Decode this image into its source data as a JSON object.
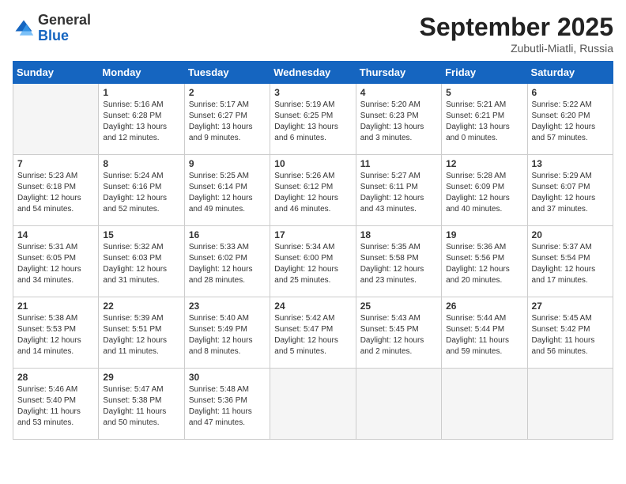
{
  "header": {
    "logo_general": "General",
    "logo_blue": "Blue",
    "month_year": "September 2025",
    "location": "Zubutli-Miatli, Russia"
  },
  "days_of_week": [
    "Sunday",
    "Monday",
    "Tuesday",
    "Wednesday",
    "Thursday",
    "Friday",
    "Saturday"
  ],
  "weeks": [
    [
      {
        "day": "",
        "info": ""
      },
      {
        "day": "1",
        "info": "Sunrise: 5:16 AM\nSunset: 6:28 PM\nDaylight: 13 hours\nand 12 minutes."
      },
      {
        "day": "2",
        "info": "Sunrise: 5:17 AM\nSunset: 6:27 PM\nDaylight: 13 hours\nand 9 minutes."
      },
      {
        "day": "3",
        "info": "Sunrise: 5:19 AM\nSunset: 6:25 PM\nDaylight: 13 hours\nand 6 minutes."
      },
      {
        "day": "4",
        "info": "Sunrise: 5:20 AM\nSunset: 6:23 PM\nDaylight: 13 hours\nand 3 minutes."
      },
      {
        "day": "5",
        "info": "Sunrise: 5:21 AM\nSunset: 6:21 PM\nDaylight: 13 hours\nand 0 minutes."
      },
      {
        "day": "6",
        "info": "Sunrise: 5:22 AM\nSunset: 6:20 PM\nDaylight: 12 hours\nand 57 minutes."
      }
    ],
    [
      {
        "day": "7",
        "info": "Sunrise: 5:23 AM\nSunset: 6:18 PM\nDaylight: 12 hours\nand 54 minutes."
      },
      {
        "day": "8",
        "info": "Sunrise: 5:24 AM\nSunset: 6:16 PM\nDaylight: 12 hours\nand 52 minutes."
      },
      {
        "day": "9",
        "info": "Sunrise: 5:25 AM\nSunset: 6:14 PM\nDaylight: 12 hours\nand 49 minutes."
      },
      {
        "day": "10",
        "info": "Sunrise: 5:26 AM\nSunset: 6:12 PM\nDaylight: 12 hours\nand 46 minutes."
      },
      {
        "day": "11",
        "info": "Sunrise: 5:27 AM\nSunset: 6:11 PM\nDaylight: 12 hours\nand 43 minutes."
      },
      {
        "day": "12",
        "info": "Sunrise: 5:28 AM\nSunset: 6:09 PM\nDaylight: 12 hours\nand 40 minutes."
      },
      {
        "day": "13",
        "info": "Sunrise: 5:29 AM\nSunset: 6:07 PM\nDaylight: 12 hours\nand 37 minutes."
      }
    ],
    [
      {
        "day": "14",
        "info": "Sunrise: 5:31 AM\nSunset: 6:05 PM\nDaylight: 12 hours\nand 34 minutes."
      },
      {
        "day": "15",
        "info": "Sunrise: 5:32 AM\nSunset: 6:03 PM\nDaylight: 12 hours\nand 31 minutes."
      },
      {
        "day": "16",
        "info": "Sunrise: 5:33 AM\nSunset: 6:02 PM\nDaylight: 12 hours\nand 28 minutes."
      },
      {
        "day": "17",
        "info": "Sunrise: 5:34 AM\nSunset: 6:00 PM\nDaylight: 12 hours\nand 25 minutes."
      },
      {
        "day": "18",
        "info": "Sunrise: 5:35 AM\nSunset: 5:58 PM\nDaylight: 12 hours\nand 23 minutes."
      },
      {
        "day": "19",
        "info": "Sunrise: 5:36 AM\nSunset: 5:56 PM\nDaylight: 12 hours\nand 20 minutes."
      },
      {
        "day": "20",
        "info": "Sunrise: 5:37 AM\nSunset: 5:54 PM\nDaylight: 12 hours\nand 17 minutes."
      }
    ],
    [
      {
        "day": "21",
        "info": "Sunrise: 5:38 AM\nSunset: 5:53 PM\nDaylight: 12 hours\nand 14 minutes."
      },
      {
        "day": "22",
        "info": "Sunrise: 5:39 AM\nSunset: 5:51 PM\nDaylight: 12 hours\nand 11 minutes."
      },
      {
        "day": "23",
        "info": "Sunrise: 5:40 AM\nSunset: 5:49 PM\nDaylight: 12 hours\nand 8 minutes."
      },
      {
        "day": "24",
        "info": "Sunrise: 5:42 AM\nSunset: 5:47 PM\nDaylight: 12 hours\nand 5 minutes."
      },
      {
        "day": "25",
        "info": "Sunrise: 5:43 AM\nSunset: 5:45 PM\nDaylight: 12 hours\nand 2 minutes."
      },
      {
        "day": "26",
        "info": "Sunrise: 5:44 AM\nSunset: 5:44 PM\nDaylight: 11 hours\nand 59 minutes."
      },
      {
        "day": "27",
        "info": "Sunrise: 5:45 AM\nSunset: 5:42 PM\nDaylight: 11 hours\nand 56 minutes."
      }
    ],
    [
      {
        "day": "28",
        "info": "Sunrise: 5:46 AM\nSunset: 5:40 PM\nDaylight: 11 hours\nand 53 minutes."
      },
      {
        "day": "29",
        "info": "Sunrise: 5:47 AM\nSunset: 5:38 PM\nDaylight: 11 hours\nand 50 minutes."
      },
      {
        "day": "30",
        "info": "Sunrise: 5:48 AM\nSunset: 5:36 PM\nDaylight: 11 hours\nand 47 minutes."
      },
      {
        "day": "",
        "info": ""
      },
      {
        "day": "",
        "info": ""
      },
      {
        "day": "",
        "info": ""
      },
      {
        "day": "",
        "info": ""
      }
    ]
  ]
}
